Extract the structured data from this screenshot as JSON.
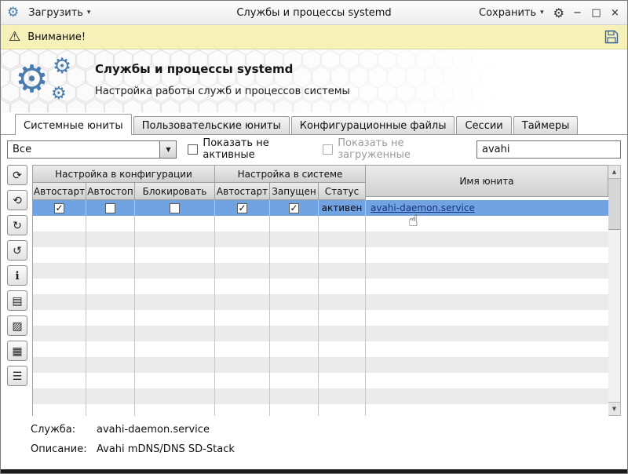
{
  "titlebar": {
    "load_label": "Загрузить",
    "title": "Службы и процессы systemd",
    "save_label": "Сохранить",
    "minimize_glyph": "−",
    "maximize_glyph": "□",
    "close_glyph": "×"
  },
  "icons": {
    "gear": "⚙",
    "dropdown_arrow": "▾",
    "combo_arrow": "▼",
    "warning": "⚠",
    "arrow_up": "▲",
    "arrow_down": "▼",
    "cursor_hand": "☝"
  },
  "warning_bar": {
    "label": "Внимание!"
  },
  "header": {
    "title": "Службы и процессы systemd",
    "subtitle": "Настройка работы служб и процессов системы"
  },
  "tabs": [
    {
      "label": "Системные юниты"
    },
    {
      "label": "Пользовательские юниты"
    },
    {
      "label": "Конфигурационные файлы"
    },
    {
      "label": "Сессии"
    },
    {
      "label": "Таймеры"
    }
  ],
  "filters": {
    "dropdown_value": "Все",
    "show_inactive_label": "Показать не активные",
    "show_unloaded_label": "Показать не загруженные",
    "search_value": "avahi"
  },
  "side_toolbar": {
    "buttons": [
      {
        "name": "refresh",
        "glyph": "⟳"
      },
      {
        "name": "reload-units",
        "glyph": "⟲"
      },
      {
        "name": "redo",
        "glyph": "↻"
      },
      {
        "name": "undo",
        "glyph": "↺"
      },
      {
        "name": "info",
        "glyph": "ℹ"
      },
      {
        "name": "unit-file",
        "glyph": "▤"
      },
      {
        "name": "journal",
        "glyph": "▨"
      },
      {
        "name": "console",
        "glyph": "▦"
      },
      {
        "name": "list",
        "glyph": "☰"
      }
    ]
  },
  "table": {
    "group_config": "Настройка в конфигурации",
    "group_system": "Настройка в системе",
    "name_header": "Имя юнита",
    "columns": [
      "Автостарт",
      "Автостоп",
      "Блокировать",
      "Автостарт",
      "Запущен",
      "Статус"
    ],
    "rows": [
      {
        "config_autostart": true,
        "config_autostop": false,
        "config_block": false,
        "system_autostart": true,
        "system_running": true,
        "status": "активен",
        "unit_name": "avahi-daemon.service"
      }
    ]
  },
  "footer": {
    "service_label": "Служба:",
    "service_value": "avahi-daemon.service",
    "description_label": "Описание:",
    "description_value": "Avahi mDNS/DNS SD-Stack"
  },
  "colors": {
    "accent_blue": "#4a7dae",
    "selection_blue": "#71a3e2",
    "warning_bg": "#f5f1b9",
    "link_blue": "#16337e"
  }
}
